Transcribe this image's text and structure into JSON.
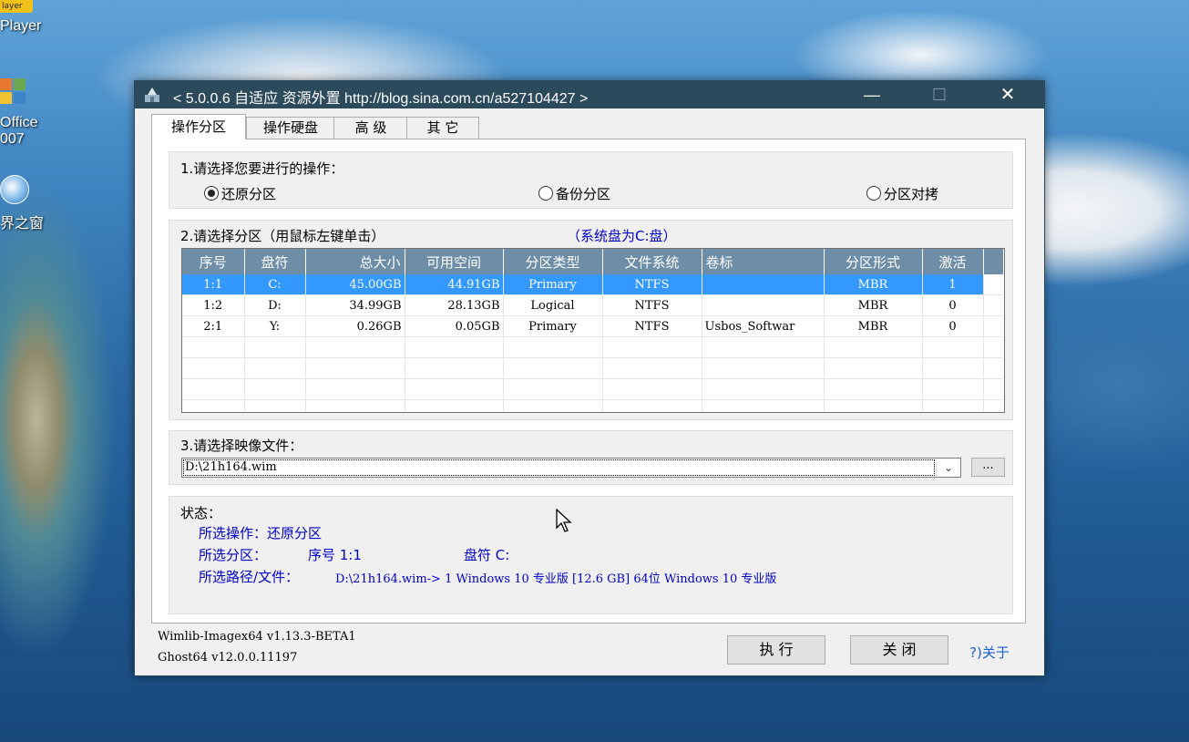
{
  "desktop": {
    "icons": [
      {
        "label": "Player",
        "badge": "layer"
      },
      {
        "label": "Office\n007"
      },
      {
        "label": "界之窗"
      }
    ]
  },
  "window": {
    "title": "< 5.0.0.6 自适应 资源外置 http://blog.sina.com.cn/a527104427 >",
    "minimize": "—",
    "maximize": "☐",
    "close": "✕"
  },
  "tabs": [
    {
      "label": "操作分区",
      "active": true
    },
    {
      "label": "操作硬盘"
    },
    {
      "label": "高 级"
    },
    {
      "label": "其 它"
    }
  ],
  "section1": {
    "label": "1.请选择您要进行的操作：",
    "options": [
      {
        "label": "还原分区",
        "checked": true
      },
      {
        "label": "备份分区",
        "checked": false
      },
      {
        "label": "分区对拷",
        "checked": false
      }
    ]
  },
  "section2": {
    "label": "2.请选择分区（用鼠标左键单击）",
    "system_hint": "（系统盘为C:盘）",
    "columns": [
      "序号",
      "盘符",
      "总大小",
      "可用空间",
      "分区类型",
      "文件系统",
      "卷标",
      "分区形式",
      "激活"
    ],
    "rows": [
      [
        "1:1",
        "C:",
        "45.00GB",
        "44.91GB",
        "Primary",
        "NTFS",
        "",
        "MBR",
        "1"
      ],
      [
        "1:2",
        "D:",
        "34.99GB",
        "28.13GB",
        "Logical",
        "NTFS",
        "",
        "MBR",
        "0"
      ],
      [
        "2:1",
        "Y:",
        "0.26GB",
        "0.05GB",
        "Primary",
        "NTFS",
        "Usbos_Softwar",
        "MBR",
        "0"
      ]
    ],
    "selected_row": 0
  },
  "section3": {
    "label": "3.请选择映像文件：",
    "path": "D:\\21h164.wim",
    "browse": "..."
  },
  "status": {
    "label": "状态：",
    "op": "所选操作：还原分区",
    "part_prefix": "所选分区：",
    "part_seq": "序号 1:1",
    "part_drive": "盘符 C:",
    "path_prefix": "所选路径/文件：",
    "path_value": "D:\\21h164.wim-> 1 Windows 10 专业版 [12.6 GB] 64位 Windows 10 专业版"
  },
  "footer": {
    "wimlib": "Wimlib-Imagex64 v1.13.3-BETA1",
    "ghost": "Ghost64 v12.0.0.11197",
    "execute": "执 行",
    "close": "关 闭",
    "about": "?)关于"
  }
}
